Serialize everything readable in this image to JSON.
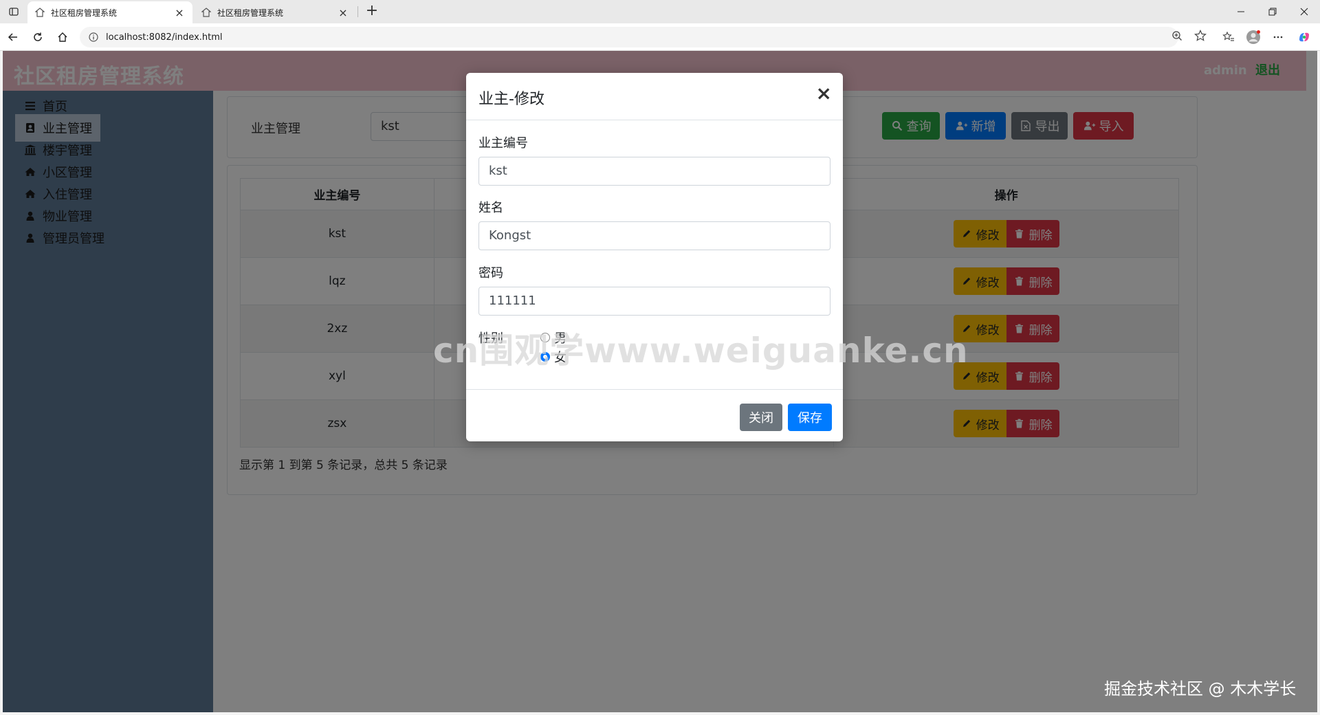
{
  "browser": {
    "tabs": [
      {
        "title": "社区租房管理系统",
        "active": true
      },
      {
        "title": "社区租房管理系统",
        "active": false
      }
    ],
    "url": "localhost:8082/index.html"
  },
  "app": {
    "title": "社区租房管理系统",
    "user": "admin",
    "logout": "退出"
  },
  "sidebar": {
    "items": [
      {
        "label": "首页",
        "icon": "menu-icon"
      },
      {
        "label": "业主管理",
        "icon": "owner-icon",
        "active": true
      },
      {
        "label": "楼宇管理",
        "icon": "building-icon"
      },
      {
        "label": "小区管理",
        "icon": "home-icon"
      },
      {
        "label": "入住管理",
        "icon": "home-icon"
      },
      {
        "label": "物业管理",
        "icon": "user-icon"
      },
      {
        "label": "管理员管理",
        "icon": "user-icon"
      }
    ]
  },
  "search": {
    "label": "业主管理",
    "value": "kst",
    "buttons": {
      "query": "查询",
      "add": "新增",
      "export": "导出",
      "import": "导入"
    }
  },
  "table": {
    "columns": [
      "业主编号",
      "操作"
    ],
    "rows": [
      {
        "id": "kst"
      },
      {
        "id": "lqz"
      },
      {
        "id": "2xz"
      },
      {
        "id": "xyl"
      },
      {
        "id": "zsx"
      }
    ],
    "edit_label": "修改",
    "delete_label": "删除"
  },
  "pagination": {
    "text": "显示第 1 到第 5 条记录，总共 5 条记录"
  },
  "modal": {
    "title": "业主-修改",
    "close_symbol": "×",
    "fields": {
      "id_label": "业主编号",
      "id_value": "kst",
      "name_label": "姓名",
      "name_value": "Kongst",
      "password_label": "密码",
      "password_value": "111111",
      "gender_label": "性别",
      "gender_options": [
        "男",
        "女"
      ],
      "gender_selected": "女"
    },
    "buttons": {
      "close": "关闭",
      "save": "保存"
    }
  },
  "watermarks": {
    "center": "cn围观学www.weiguanke.cn",
    "corner": "掘金技术社区 @ 木木学长"
  },
  "colors": {
    "header_bg": "#f5c3cf",
    "sidebar_bg": "#5f7a97",
    "success": "#28a745",
    "primary": "#007bff",
    "secondary": "#6c757d",
    "danger": "#dc3545",
    "warning": "#ffc107"
  }
}
